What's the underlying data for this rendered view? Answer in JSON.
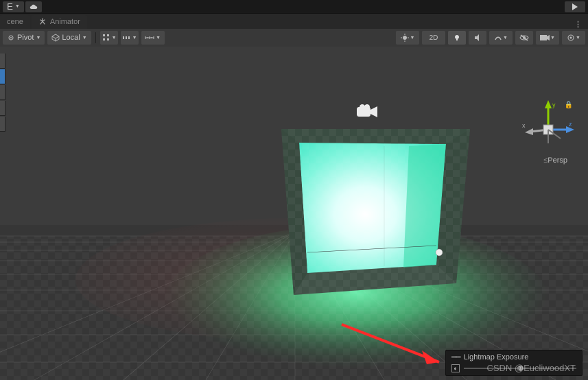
{
  "top": {
    "menu_e": "E",
    "cloud": "cloud"
  },
  "tabs": {
    "scene": "cene",
    "animator": "Animator"
  },
  "toolbar": {
    "pivot_label": "Pivot",
    "local_label": "Local",
    "two_d_label": "2D"
  },
  "gizmo": {
    "x": "x",
    "y": "y",
    "z": "z",
    "projection": "Persp"
  },
  "exposure": {
    "title": "Lightmap Exposure"
  },
  "watermark": "CSDN @EucliwoodXT"
}
